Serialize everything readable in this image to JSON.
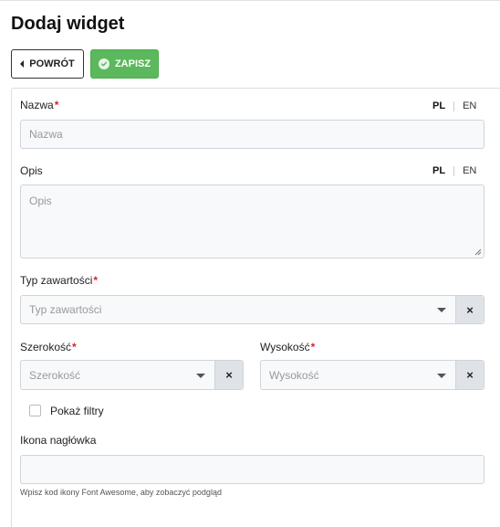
{
  "page": {
    "title": "Dodaj widget"
  },
  "toolbar": {
    "back_label": "POWRÓT",
    "save_label": "ZAPISZ"
  },
  "form": {
    "name": {
      "label": "Nazwa",
      "required_mark": "*",
      "placeholder": "Nazwa",
      "lang_pl": "PL",
      "lang_en": "EN"
    },
    "description": {
      "label": "Opis",
      "placeholder": "Opis",
      "lang_pl": "PL",
      "lang_en": "EN"
    },
    "content_type": {
      "label": "Typ zawartości",
      "required_mark": "*",
      "placeholder": "Typ zawartości",
      "clear": "×"
    },
    "width": {
      "label": "Szerokość",
      "required_mark": "*",
      "placeholder": "Szerokość",
      "clear": "×"
    },
    "height": {
      "label": "Wysokość",
      "required_mark": "*",
      "placeholder": "Wysokość",
      "clear": "×"
    },
    "show_filters": {
      "label": "Pokaż filtry",
      "checked": false
    },
    "header_icon": {
      "label": "Ikona nagłówka",
      "value": "",
      "hint": "Wpisz kod ikony Font Awesome, aby zobaczyć podgląd"
    }
  },
  "colors": {
    "save_button": "#5cb85c",
    "required": "#d9232d"
  }
}
